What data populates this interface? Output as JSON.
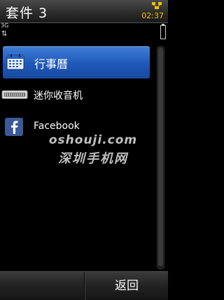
{
  "header": {
    "title": "套件 3",
    "clock": "02:37",
    "network": "3G",
    "activity_icon": "data-transfer-icon",
    "battery_icon": "battery-icon"
  },
  "list": {
    "items": [
      {
        "label": "行事曆",
        "icon": "calendar-icon",
        "selected": true
      },
      {
        "label": "迷你收音机",
        "icon": "radio-icon",
        "selected": false
      },
      {
        "label": "Facebook",
        "icon": "facebook-icon",
        "selected": false
      }
    ]
  },
  "watermark": {
    "line1": "oshouji.com",
    "line2": "深圳手机网"
  },
  "softkeys": {
    "right_label": "返回"
  },
  "colors": {
    "selection": "#1f58b8",
    "clock": "#f2c200",
    "background": "#000000"
  }
}
